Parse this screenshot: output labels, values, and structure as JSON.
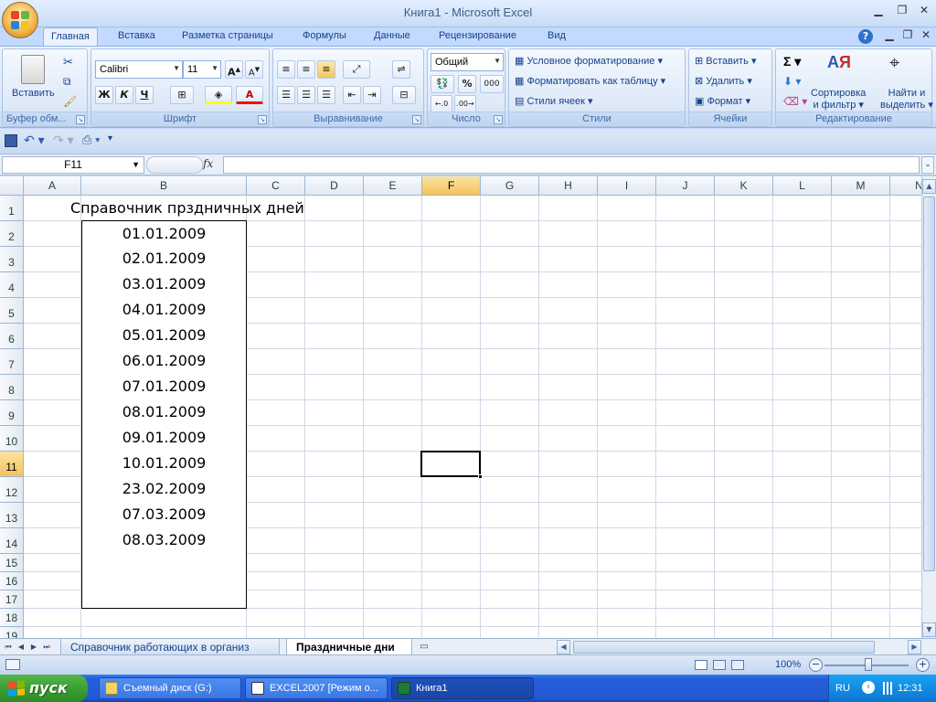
{
  "window": {
    "title": "Книга1 - Microsoft Excel"
  },
  "tabs": [
    "Главная",
    "Вставка",
    "Разметка страницы",
    "Формулы",
    "Данные",
    "Рецензирование",
    "Вид"
  ],
  "ribbon": {
    "clipboard": {
      "label": "Буфер обм...",
      "paste": "Вставить"
    },
    "font": {
      "label": "Шрифт",
      "name": "Calibri",
      "size": "11",
      "bold": "Ж",
      "italic": "К",
      "underline": "Ч"
    },
    "alignment": {
      "label": "Выравнивание"
    },
    "number": {
      "label": "Число",
      "format": "Общий",
      "percent": "%",
      "thousands": "000"
    },
    "styles": {
      "label": "Стили",
      "conditional": "Условное форматирование",
      "format_table": "Форматировать как таблицу",
      "cell_styles": "Стили ячеек"
    },
    "cells": {
      "label": "Ячейки",
      "insert": "Вставить",
      "delete": "Удалить",
      "format": "Формат"
    },
    "editing": {
      "label": "Редактирование",
      "sort_1": "Сортировка",
      "sort_2": "и фильтр",
      "find_1": "Найти и",
      "find_2": "выделить"
    }
  },
  "formula_bar": {
    "name_box": "F11",
    "fx": "fx",
    "value": ""
  },
  "columns": [
    "A",
    "B",
    "C",
    "D",
    "E",
    "F",
    "G",
    "H",
    "I",
    "J",
    "K",
    "L",
    "M",
    "N"
  ],
  "selected_column": "F",
  "selected_row": 11,
  "rows": [
    1,
    2,
    3,
    4,
    5,
    6,
    7,
    8,
    9,
    10,
    11,
    12,
    13,
    14,
    15,
    16,
    17,
    18,
    19
  ],
  "sheet": {
    "title": "Справочник прздничных дней",
    "dates": [
      "01.01.2009",
      "02.01.2009",
      "03.01.2009",
      "04.01.2009",
      "05.01.2009",
      "06.01.2009",
      "07.01.2009",
      "08.01.2009",
      "09.01.2009",
      "10.01.2009",
      "23.02.2009",
      "07.03.2009",
      "08.03.2009",
      "",
      "",
      ""
    ]
  },
  "sheet_tabs": [
    {
      "name": "Справочник работающих в организ",
      "active": false
    },
    {
      "name": "Праздничные дни",
      "active": true
    }
  ],
  "status": {
    "zoom": "100%"
  },
  "taskbar": {
    "start": "пуск",
    "tasks": [
      "Съемный диск (G:)",
      "EXCEL2007 [Режим о...",
      "Книга1"
    ],
    "lang": "RU",
    "clock": "12:31"
  },
  "colors": {
    "accent": "#15428b",
    "selection_header": "#f5c25c",
    "taskbar": "#245edb",
    "start": "#3c9f33"
  }
}
